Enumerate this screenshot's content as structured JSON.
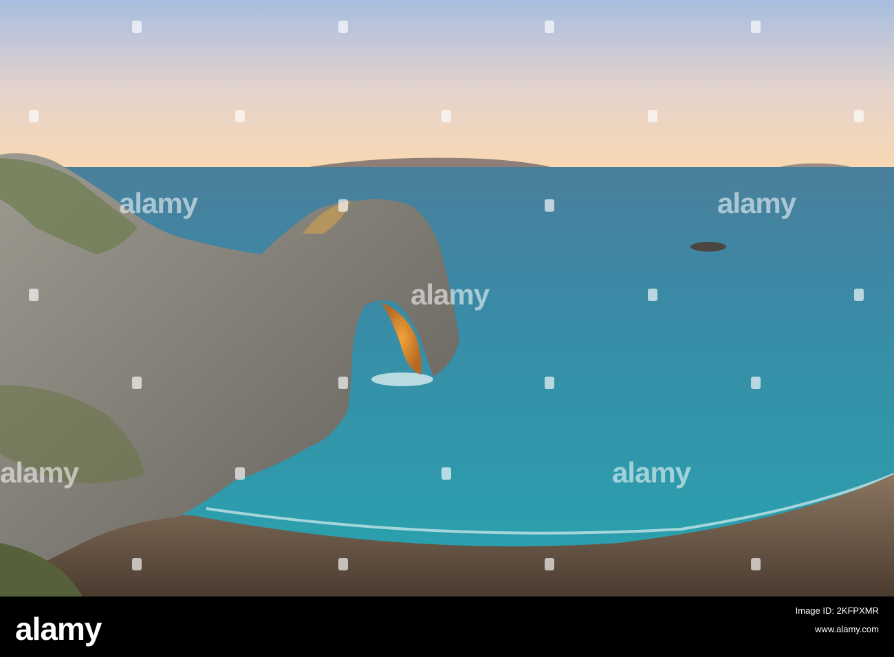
{
  "watermark": {
    "brand": "alamy"
  },
  "footer": {
    "brand": "alamy",
    "image_id": "Image ID: 2KFPXMR",
    "domain": "www.alamy.com"
  },
  "colors": {
    "sky_top": "#a9bfe0",
    "sky_horizon": "#f6d7b6",
    "sea_far": "#3f7f9e",
    "sea_near": "#2e9aa8",
    "rock": "#8d8a82",
    "sand": "#6d5a46",
    "footer_bg": "#000000"
  }
}
